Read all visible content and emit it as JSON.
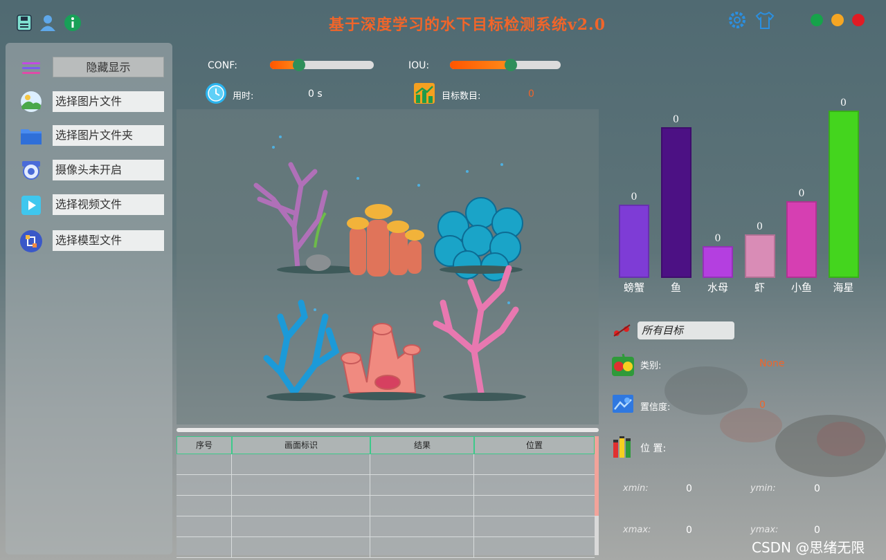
{
  "app": {
    "title": "基于深度学习的水下目标检测系统v2.0"
  },
  "colors": {
    "accent": "#f0652a",
    "close": "#e01b24",
    "minimize": "#f5a623",
    "maximize": "#16a34a"
  },
  "sidebar": {
    "items": [
      {
        "label": "隐藏显示",
        "icon": "menu-icon"
      },
      {
        "label": "选择图片文件",
        "icon": "image-icon"
      },
      {
        "label": "选择图片文件夹",
        "icon": "folder-icon"
      },
      {
        "label": "摄像头未开启",
        "icon": "camera-icon"
      },
      {
        "label": "选择视频文件",
        "icon": "video-icon"
      },
      {
        "label": "选择模型文件",
        "icon": "model-icon"
      }
    ]
  },
  "controls": {
    "conf_label": "CONF:",
    "conf_value": 0.28,
    "iou_label": "IOU:",
    "iou_value": 0.55,
    "time_label": "用时:",
    "time_value": "0 s",
    "count_label": "目标数目:",
    "count_value": "0"
  },
  "table": {
    "headers": [
      "序号",
      "画面标识",
      "结果",
      "位置"
    ],
    "rows": 5
  },
  "chart_data": {
    "type": "bar",
    "categories": [
      "螃蟹",
      "鱼",
      "水母",
      "虾",
      "小鱼",
      "海星"
    ],
    "values": [
      0,
      0,
      0,
      0,
      0,
      0
    ],
    "bar_heights_relative": [
      0.44,
      0.9,
      0.19,
      0.26,
      0.46,
      1.0
    ],
    "colors": [
      "#7e3cd6",
      "#4c1184",
      "#b43fe0",
      "#d98cb6",
      "#d63fb2",
      "#44d51e"
    ]
  },
  "detail": {
    "target_select": "所有目标",
    "class_label": "类别:",
    "class_value": "None",
    "conf_label": "置信度:",
    "conf_value": "0",
    "pos_label": "位 置:",
    "xmin_label": "xmin:",
    "xmin_value": "0",
    "ymin_label": "ymin:",
    "ymin_value": "0",
    "xmax_label": "xmax:",
    "xmax_value": "0",
    "ymax_label": "ymax:",
    "ymax_value": "0"
  },
  "watermark": "CSDN @思绪无限"
}
